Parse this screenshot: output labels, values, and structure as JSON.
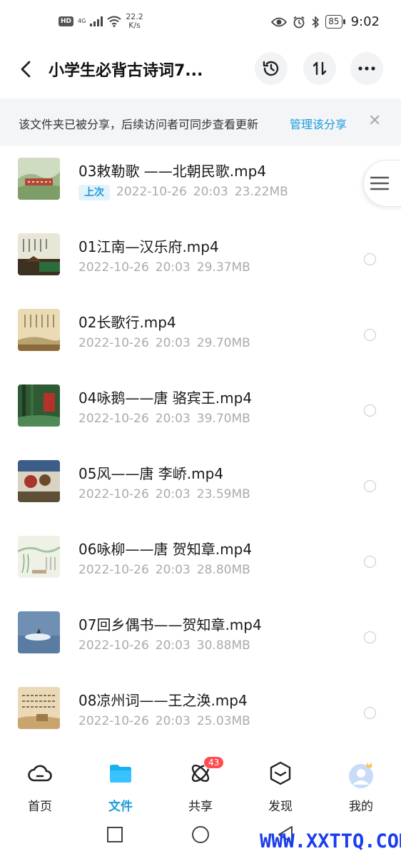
{
  "status_bar": {
    "hd": "HD",
    "network": "4G",
    "speed_value": "22.2",
    "speed_unit": "K/s",
    "battery": "85",
    "time": "9:02"
  },
  "header": {
    "title": "小学生必背古诗词7...",
    "icons": {
      "back": "back-arrow-icon",
      "history": "history-icon",
      "sort": "sort-icon",
      "more": "more-icon"
    }
  },
  "share_banner": {
    "text": "该文件夹已被分享，后续访问者可同步查看更新",
    "manage_link": "管理该分享",
    "close": "✕"
  },
  "files": [
    {
      "name": "03敕勒歌 ——北朝民歌.mp4",
      "badge": "上次",
      "date": "2022-10-26",
      "time": "20:03",
      "size": "23.22MB"
    },
    {
      "name": "01江南—汉乐府.mp4",
      "badge": "",
      "date": "2022-10-26",
      "time": "20:03",
      "size": "29.37MB"
    },
    {
      "name": "02长歌行.mp4",
      "badge": "",
      "date": "2022-10-26",
      "time": "20:03",
      "size": "29.70MB"
    },
    {
      "name": "04咏鹅——唐  骆宾王.mp4",
      "badge": "",
      "date": "2022-10-26",
      "time": "20:03",
      "size": "39.70MB"
    },
    {
      "name": "05风——唐  李峤.mp4",
      "badge": "",
      "date": "2022-10-26",
      "time": "20:03",
      "size": "23.59MB"
    },
    {
      "name": "06咏柳——唐  贺知章.mp4",
      "badge": "",
      "date": "2022-10-26",
      "time": "20:03",
      "size": "28.80MB"
    },
    {
      "name": "07回乡偶书——贺知章.mp4",
      "badge": "",
      "date": "2022-10-26",
      "time": "20:03",
      "size": "30.88MB"
    },
    {
      "name": "08凉州词——王之涣.mp4",
      "badge": "",
      "date": "2022-10-26",
      "time": "20:03",
      "size": "25.03MB"
    }
  ],
  "bottom_nav": [
    {
      "label": "首页",
      "icon": "cloud-home-icon",
      "active": false
    },
    {
      "label": "文件",
      "icon": "folder-icon",
      "active": true
    },
    {
      "label": "共享",
      "icon": "share-atom-icon",
      "active": false,
      "badge": "43"
    },
    {
      "label": "发现",
      "icon": "discover-box-icon",
      "active": false
    },
    {
      "label": "我的",
      "icon": "avatar-icon",
      "active": false
    }
  ],
  "watermark": "WWW.XXTTQ.COM",
  "colors": {
    "accent": "#1a9bdb",
    "badge": "#ff4d4f",
    "meta": "#a8abb0",
    "banner_bg": "#f4f5f7"
  }
}
